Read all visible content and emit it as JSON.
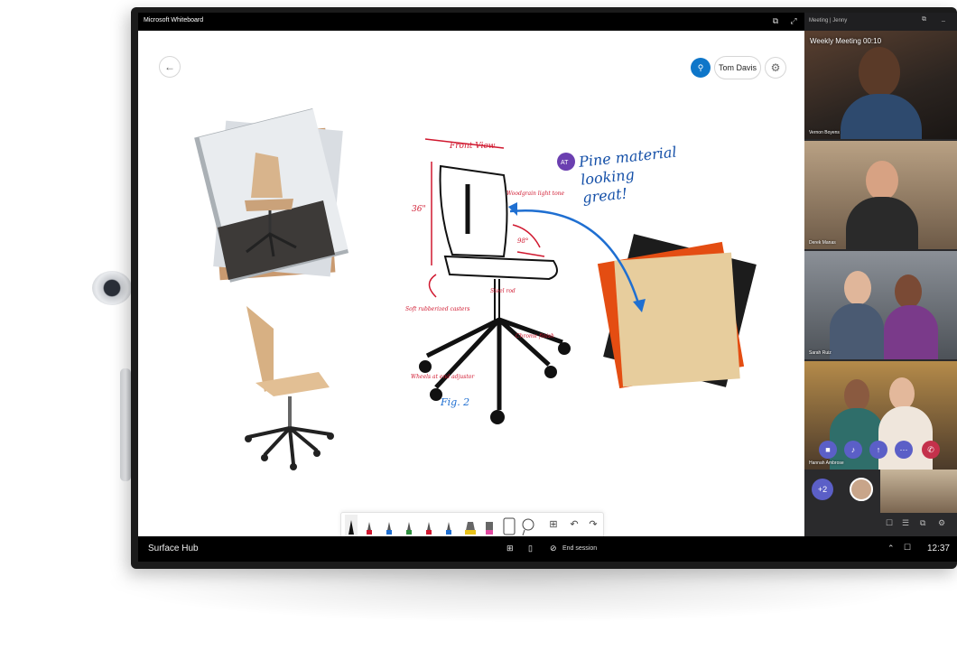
{
  "device": {
    "label": "Surface Hub"
  },
  "whiteboard": {
    "app_title": "Microsoft Whiteboard",
    "back_icon": "back-arrow-icon",
    "user_name": "Tom Davis",
    "user_avatar_icon": "person-icon",
    "settings_icon": "gear-icon"
  },
  "canvas": {
    "sketch_labels": {
      "front_view": "Front View",
      "fig": "Fig. 2",
      "note_height": "36\"",
      "note_angle": "98°",
      "note_woodgrain": "Woodgrain light tone",
      "note_swivel": "Soft rubberized casters",
      "note_chrome": "Chrome finish",
      "note_wheels": "Wheels at end adjustor",
      "note_steel": "Steel rod"
    },
    "comment_author": "AT",
    "comment_text": "Pine material looking great!"
  },
  "toolbar": {
    "tools": [
      "pen-black",
      "pen-red",
      "pen-blue",
      "pen-green",
      "pen-red2",
      "pen-blue2",
      "highlighter-yellow",
      "highlighter-pink",
      "ruler",
      "lasso",
      "add",
      "undo",
      "redo"
    ],
    "colors": {
      "black": "#111111",
      "red": "#d0182f",
      "blue": "#1f6fd1",
      "green": "#2f8f3f",
      "yellow": "#e8c21a",
      "pink": "#e24aa0"
    }
  },
  "taskbar": {
    "end_session": "End session",
    "time": "12:37"
  },
  "meeting": {
    "window_title": "Meeting | Jenny",
    "title": "Weekly Meeting",
    "duration": "00:10",
    "participants": [
      {
        "name": "Vernon Boyens"
      },
      {
        "name": "Derek Manas"
      },
      {
        "name": "Sarah Ruiz"
      },
      {
        "name": "Hannah Ambrose"
      }
    ],
    "more_count": "+2",
    "controls": [
      "video-icon",
      "mic-icon",
      "share-icon",
      "more-icon",
      "hangup-icon"
    ],
    "accent": "#5b5fc7",
    "hangup_color": "#c4314b"
  }
}
